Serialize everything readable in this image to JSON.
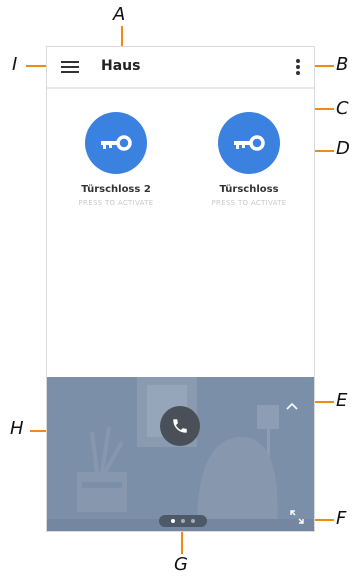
{
  "callouts": {
    "A": "A",
    "B": "B",
    "C": "C",
    "D": "D",
    "E": "E",
    "F": "F",
    "G": "G",
    "H": "H",
    "I": "I"
  },
  "header": {
    "title": "Haus"
  },
  "locks": [
    {
      "name": "Türschloss 2",
      "hint": "PRESS TO ACTIVATE"
    },
    {
      "name": "Türschloss",
      "hint": "PRESS TO ACTIVATE"
    }
  ],
  "icons": {
    "menu": "hamburger-menu-icon",
    "more": "vertical-ellipsis-icon",
    "lock": "key-icon",
    "call": "phone-icon",
    "collapse": "chevron-up-icon",
    "fullscreen": "expand-icon"
  },
  "colors": {
    "accent": "#f08a14",
    "lock_button": "#3b82e0",
    "video_bg": "#7c8fa8"
  },
  "pager": {
    "total": 3,
    "active": 1
  }
}
